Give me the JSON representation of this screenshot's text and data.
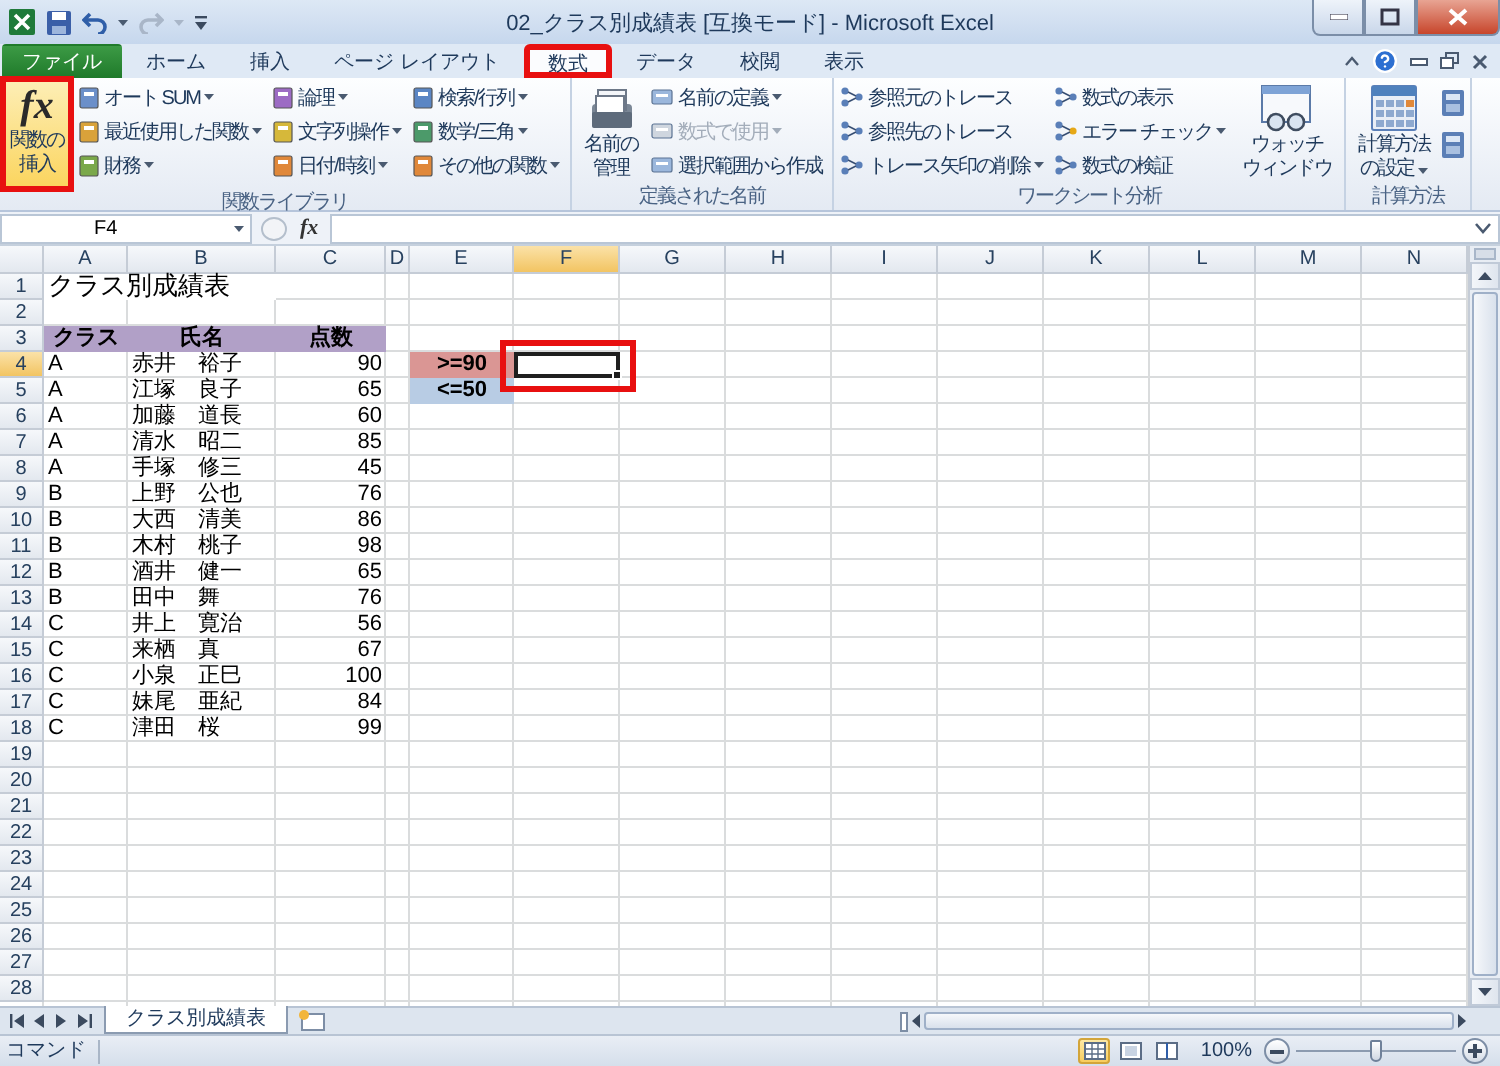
{
  "window": {
    "title": "02_クラス別成績表 [互換モード] - Microsoft Excel"
  },
  "ribbon_tabs": [
    {
      "label": "ファイル",
      "kind": "file",
      "selected": false,
      "highlighted": false
    },
    {
      "label": "ホーム",
      "kind": "tab",
      "selected": false,
      "highlighted": false
    },
    {
      "label": "挿入",
      "kind": "tab",
      "selected": false,
      "highlighted": false
    },
    {
      "label": "ページ レイアウト",
      "kind": "tab",
      "selected": false,
      "highlighted": false
    },
    {
      "label": "数式",
      "kind": "tab",
      "selected": true,
      "highlighted": true
    },
    {
      "label": "データ",
      "kind": "tab",
      "selected": false,
      "highlighted": false
    },
    {
      "label": "校閲",
      "kind": "tab",
      "selected": false,
      "highlighted": false
    },
    {
      "label": "表示",
      "kind": "tab",
      "selected": false,
      "highlighted": false
    }
  ],
  "ribbon": {
    "groups": [
      {
        "label": "関数ライブラリ",
        "parts": [
          {
            "kind": "large",
            "lines": [
              "関数の",
              "挿入"
            ],
            "glyph": "fx",
            "dropdown": false,
            "highlighted": true
          },
          {
            "kind": "stack",
            "items": [
              {
                "label": "オート SUM",
                "dropdown": true,
                "disabled": false
              },
              {
                "label": "最近使用した関数",
                "dropdown": true,
                "disabled": false
              },
              {
                "label": "財務",
                "dropdown": true,
                "disabled": false
              }
            ]
          },
          {
            "kind": "stack",
            "items": [
              {
                "label": "論理",
                "dropdown": true,
                "disabled": false
              },
              {
                "label": "文字列操作",
                "dropdown": true,
                "disabled": false
              },
              {
                "label": "日付/時刻",
                "dropdown": true,
                "disabled": false
              }
            ]
          },
          {
            "kind": "stack",
            "items": [
              {
                "label": "検索/行列",
                "dropdown": true,
                "disabled": false
              },
              {
                "label": "数学/三角",
                "dropdown": true,
                "disabled": false
              },
              {
                "label": "その他の関数",
                "dropdown": true,
                "disabled": false
              }
            ]
          }
        ]
      },
      {
        "label": "定義された名前",
        "parts": [
          {
            "kind": "large",
            "lines": [
              "名前の",
              "管理"
            ],
            "dropdown": false,
            "highlighted": false
          },
          {
            "kind": "stack",
            "items": [
              {
                "label": "名前の定義",
                "dropdown": true,
                "disabled": false
              },
              {
                "label": "数式で使用",
                "dropdown": true,
                "disabled": true
              },
              {
                "label": "選択範囲から作成",
                "dropdown": false,
                "disabled": false
              }
            ]
          }
        ]
      },
      {
        "label": "ワークシート分析",
        "parts": [
          {
            "kind": "stack",
            "items": [
              {
                "label": "参照元のトレース",
                "dropdown": false,
                "disabled": false
              },
              {
                "label": "参照先のトレース",
                "dropdown": false,
                "disabled": false
              },
              {
                "label": "トレース矢印の削除",
                "dropdown": true,
                "disabled": false
              }
            ]
          },
          {
            "kind": "stack",
            "items": [
              {
                "label": "数式の表示",
                "dropdown": false,
                "disabled": false
              },
              {
                "label": "エラー チェック",
                "dropdown": true,
                "disabled": false
              },
              {
                "label": "数式の検証",
                "dropdown": false,
                "disabled": false
              }
            ]
          },
          {
            "kind": "large",
            "lines": [
              "ウォッチ",
              "ウィンドウ"
            ],
            "dropdown": false,
            "highlighted": false
          }
        ]
      },
      {
        "label": "計算方法",
        "parts": [
          {
            "kind": "large",
            "lines": [
              "計算方法",
              "の設定"
            ],
            "dropdown": true,
            "highlighted": false
          },
          {
            "kind": "icons"
          }
        ]
      }
    ]
  },
  "formula_bar": {
    "name_box": "F4",
    "fx_label": "fx"
  },
  "sheet": {
    "columns": [
      {
        "label": "A",
        "selected": false
      },
      {
        "label": "B",
        "selected": false
      },
      {
        "label": "C",
        "selected": false
      },
      {
        "label": "D",
        "selected": false
      },
      {
        "label": "E",
        "selected": false
      },
      {
        "label": "F",
        "selected": true
      },
      {
        "label": "G",
        "selected": false
      },
      {
        "label": "H",
        "selected": false
      },
      {
        "label": "I",
        "selected": false
      },
      {
        "label": "J",
        "selected": false
      },
      {
        "label": "K",
        "selected": false
      },
      {
        "label": "L",
        "selected": false
      },
      {
        "label": "M",
        "selected": false
      },
      {
        "label": "N",
        "selected": false
      }
    ],
    "rows": [
      {
        "label": "1",
        "selected": false
      },
      {
        "label": "2",
        "selected": false
      },
      {
        "label": "3",
        "selected": false
      },
      {
        "label": "4",
        "selected": true
      },
      {
        "label": "5",
        "selected": false
      },
      {
        "label": "6",
        "selected": false
      },
      {
        "label": "7",
        "selected": false
      },
      {
        "label": "8",
        "selected": false
      },
      {
        "label": "9",
        "selected": false
      },
      {
        "label": "10",
        "selected": false
      },
      {
        "label": "11",
        "selected": false
      },
      {
        "label": "12",
        "selected": false
      },
      {
        "label": "13",
        "selected": false
      },
      {
        "label": "14",
        "selected": false
      },
      {
        "label": "15",
        "selected": false
      },
      {
        "label": "16",
        "selected": false
      },
      {
        "label": "17",
        "selected": false
      },
      {
        "label": "18",
        "selected": false
      },
      {
        "label": "19",
        "selected": false
      },
      {
        "label": "20",
        "selected": false
      },
      {
        "label": "21",
        "selected": false
      },
      {
        "label": "22",
        "selected": false
      },
      {
        "label": "23",
        "selected": false
      },
      {
        "label": "24",
        "selected": false
      },
      {
        "label": "25",
        "selected": false
      },
      {
        "label": "26",
        "selected": false
      },
      {
        "label": "27",
        "selected": false
      },
      {
        "label": "28",
        "selected": false
      }
    ],
    "title": "クラス別成績表",
    "headers": [
      "クラス",
      "氏名",
      "点数"
    ],
    "records": [
      {
        "class": "A",
        "name": "赤井　裕子",
        "score": "90"
      },
      {
        "class": "A",
        "name": "江塚　良子",
        "score": "65"
      },
      {
        "class": "A",
        "name": "加藤　道長",
        "score": "60"
      },
      {
        "class": "A",
        "name": "清水　昭二",
        "score": "85"
      },
      {
        "class": "A",
        "name": "手塚　修三",
        "score": "45"
      },
      {
        "class": "B",
        "name": "上野　公也",
        "score": "76"
      },
      {
        "class": "B",
        "name": "大西　清美",
        "score": "86"
      },
      {
        "class": "B",
        "name": "木村　桃子",
        "score": "98"
      },
      {
        "class": "B",
        "name": "酒井　健一",
        "score": "65"
      },
      {
        "class": "B",
        "name": "田中　舞",
        "score": "76"
      },
      {
        "class": "C",
        "name": "井上　寛治",
        "score": "56"
      },
      {
        "class": "C",
        "name": "来栖　真",
        "score": "67"
      },
      {
        "class": "C",
        "name": "小泉　正巳",
        "score": "100"
      },
      {
        "class": "C",
        "name": "妹尾　亜紀",
        "score": "84"
      },
      {
        "class": "C",
        "name": "津田　桜",
        "score": "99"
      }
    ],
    "criteria": [
      {
        "text": ">=90",
        "color": "#da9694"
      },
      {
        "text": "<=50",
        "color": "#b8cce4"
      }
    ],
    "active_cell": {
      "highlighted": true
    }
  },
  "sheet_tabs": [
    {
      "label": "クラス別成績表",
      "selected": true
    }
  ],
  "status_bar": {
    "mode": "コマンド",
    "views": [
      {
        "kind": "normal",
        "selected": true
      },
      {
        "kind": "layout",
        "selected": false
      },
      {
        "kind": "pagebreak",
        "selected": false
      }
    ],
    "zoom": "100%",
    "zoom_slider": {
      "level": 0.5
    }
  }
}
